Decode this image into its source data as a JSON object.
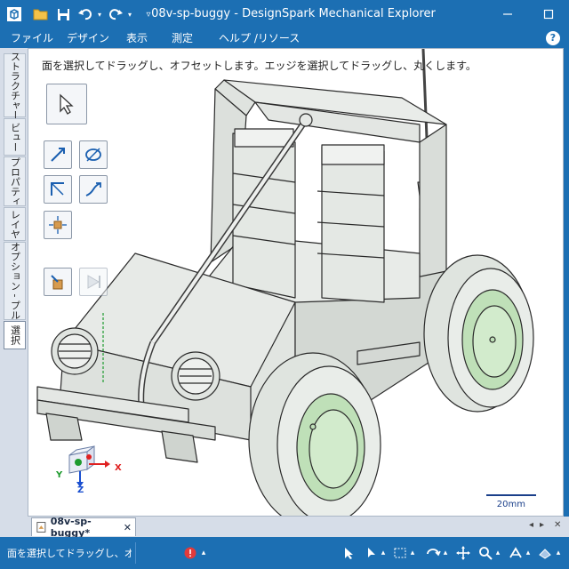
{
  "window": {
    "title": "08v-sp-buggy - DesignSpark Mechanical Explorer"
  },
  "menu": {
    "items": [
      "ファイル",
      "デザイン",
      "表示",
      "測定",
      "ヘルプ /リソース"
    ],
    "help": "?"
  },
  "side_tabs": [
    "ストラクチャー",
    "ビュー",
    "プロパティ",
    "レイヤ",
    "オプション - プル",
    "選択"
  ],
  "viewport": {
    "hint": "面を選択してドラッグし、オフセットします。エッジを選択してドラッグし、丸くします。",
    "scale_label": "20mm",
    "axes": {
      "x": "X",
      "y": "Y",
      "z": "Z"
    },
    "icons": [
      "select-arrow-icon",
      "pull-direction-icon",
      "rotate-pivot-icon",
      "fold-icon",
      "sweep-icon",
      "up-to-icon",
      "pull-solid-icon",
      "forward-disabled-icon"
    ]
  },
  "document_tab": {
    "label": "08v-sp-buggy*",
    "close": "✕"
  },
  "status": {
    "text": "面を選択してドラッグし、オフセットします。"
  },
  "colors": {
    "chrome": "#1c6fb3",
    "body_fill": "#e3e7e3",
    "rim_fill": "#bfe0b8",
    "axis_x": "#e02020",
    "axis_y": "#1f9b2f",
    "axis_z": "#1a4fd0"
  }
}
